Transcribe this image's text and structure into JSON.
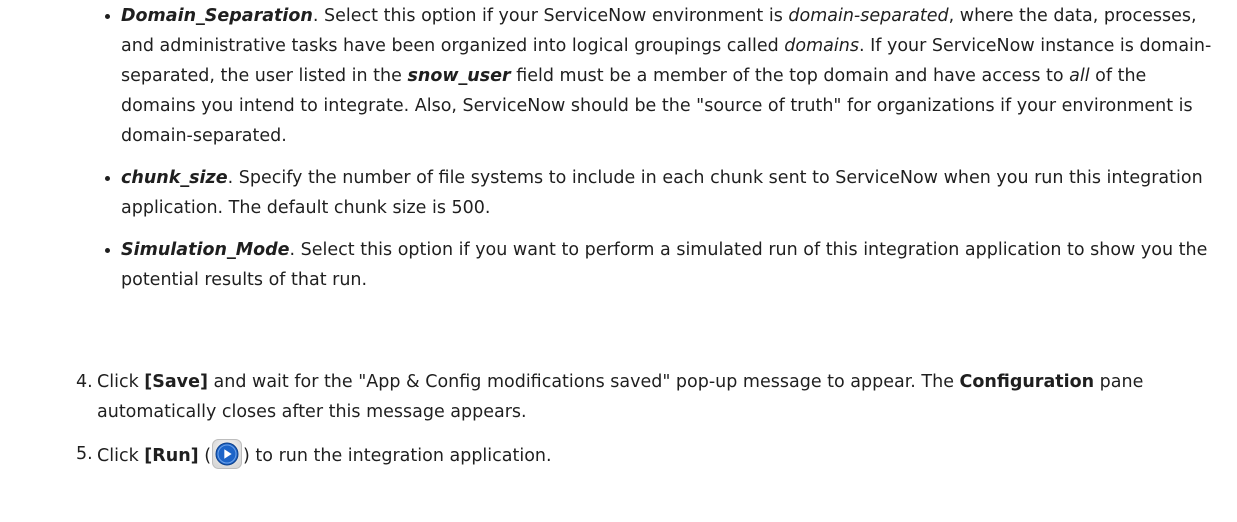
{
  "bullets": [
    {
      "term": "Domain_Separation",
      "p1": ". Select this option if your ServiceNow environment is ",
      "i1": "domain-separated",
      "p2": ", where the data, processes, and administrative tasks have been organized into logical groupings called ",
      "i2": "domains",
      "p3": ". If your ServiceNow instance is domain-separated, the user listed in the ",
      "field": "snow_user",
      "p4": " field must be a member of the top domain and have access to ",
      "i3": "all",
      "p5": " of the domains you intend to integrate. Also, ServiceNow should be the \"source of truth\" for organizations if your environment is domain-separated."
    },
    {
      "term": "chunk_size",
      "text": ". Specify the number of file systems to include in each chunk sent to ServiceNow when you run this integration application. The default chunk size is 500."
    },
    {
      "term": "Simulation_Mode",
      "text": ". Select this option if you want to perform a simulated run of this integration application to show you the potential results of that run."
    }
  ],
  "steps": [
    {
      "number": "4.",
      "t1": "Click ",
      "button": "[Save]",
      "t2": " and wait for the \"App & Config modifications saved\" pop-up message to appear. The ",
      "pane": "Configuration",
      "t3": " pane automatically closes after this message appears."
    },
    {
      "number": "5.",
      "t1": "Click ",
      "button": "[Run]",
      "t2": " (",
      "t3": ") to run the integration application.",
      "icon": "run-play-icon"
    }
  ],
  "colors": {
    "text": "#1f1f1f",
    "icon_blue": "#1c64c8"
  }
}
